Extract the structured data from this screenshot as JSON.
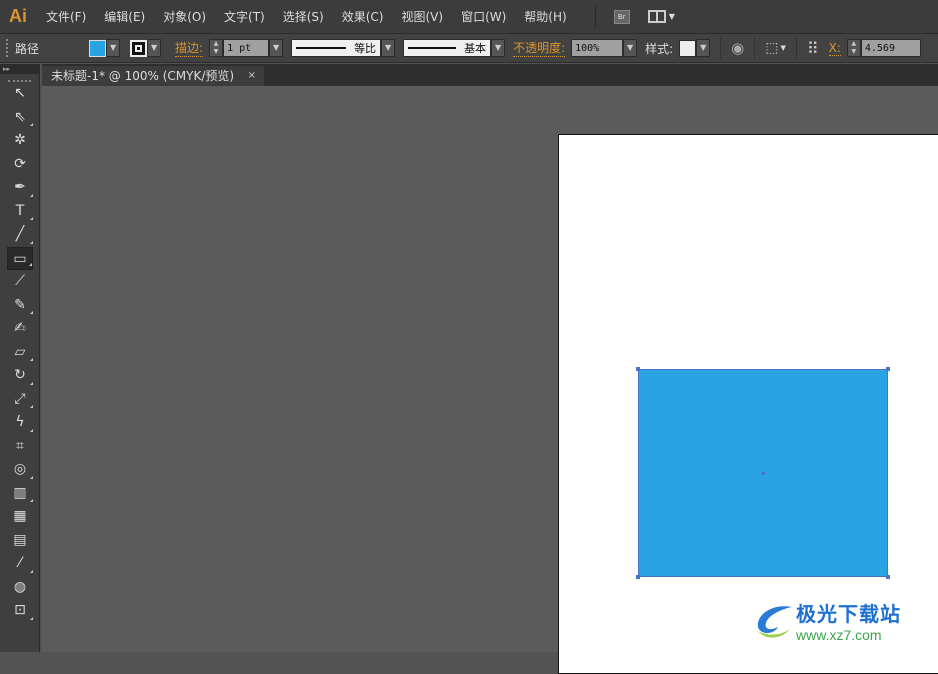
{
  "app": {
    "logo": "Ai"
  },
  "menu": [
    "文件(F)",
    "编辑(E)",
    "对象(O)",
    "文字(T)",
    "选择(S)",
    "效果(C)",
    "视图(V)",
    "窗口(W)",
    "帮助(H)"
  ],
  "bridge_label": "Br",
  "control": {
    "object_type": "路径",
    "fill_color": "#29a3e2",
    "stroke_label": "描边:",
    "stroke_weight": "1 pt",
    "profile_label": "等比",
    "brush_label": "基本",
    "opacity_label": "不透明度:",
    "opacity_value": "100%",
    "style_label": "样式:",
    "x_label": "X:",
    "x_value": "4.569"
  },
  "document_tab": {
    "title": "未标题-1* @ 100% (CMYK/预览)",
    "close": "×"
  },
  "tools": [
    {
      "name": "selection-tool",
      "glyph": "↖",
      "sub": false
    },
    {
      "name": "direct-selection-tool",
      "glyph": "⇖",
      "sub": true
    },
    {
      "name": "magic-wand-tool",
      "glyph": "✲",
      "sub": false
    },
    {
      "name": "lasso-tool",
      "glyph": "⟳",
      "sub": false
    },
    {
      "name": "pen-tool",
      "glyph": "✒",
      "sub": true
    },
    {
      "name": "type-tool",
      "glyph": "T",
      "sub": true
    },
    {
      "name": "line-segment-tool",
      "glyph": "╱",
      "sub": true
    },
    {
      "name": "rectangle-tool",
      "glyph": "▭",
      "sub": true,
      "active": true
    },
    {
      "name": "paintbrush-tool",
      "glyph": "⟋",
      "sub": false
    },
    {
      "name": "pencil-tool",
      "glyph": "✎",
      "sub": true
    },
    {
      "name": "blob-brush-tool",
      "glyph": "✍",
      "sub": false
    },
    {
      "name": "eraser-tool",
      "glyph": "▱",
      "sub": true
    },
    {
      "name": "rotate-tool",
      "glyph": "↻",
      "sub": true
    },
    {
      "name": "scale-tool",
      "glyph": "⤢",
      "sub": true
    },
    {
      "name": "warp-tool",
      "glyph": "ϟ",
      "sub": true
    },
    {
      "name": "free-transform-tool",
      "glyph": "⌗",
      "sub": false
    },
    {
      "name": "shape-builder-tool",
      "glyph": "◎",
      "sub": true
    },
    {
      "name": "graph-tool",
      "glyph": "▥",
      "sub": true
    },
    {
      "name": "mesh-tool",
      "glyph": "▦",
      "sub": false
    },
    {
      "name": "gradient-tool",
      "glyph": "▤",
      "sub": false
    },
    {
      "name": "eyedropper-tool",
      "glyph": "⁄",
      "sub": true
    },
    {
      "name": "blend-tool",
      "glyph": "◍",
      "sub": false
    },
    {
      "name": "symbol-sprayer-tool",
      "glyph": "⊡",
      "sub": true
    }
  ],
  "watermark": {
    "title": "极光下载站",
    "url": "www.xz7.com"
  }
}
